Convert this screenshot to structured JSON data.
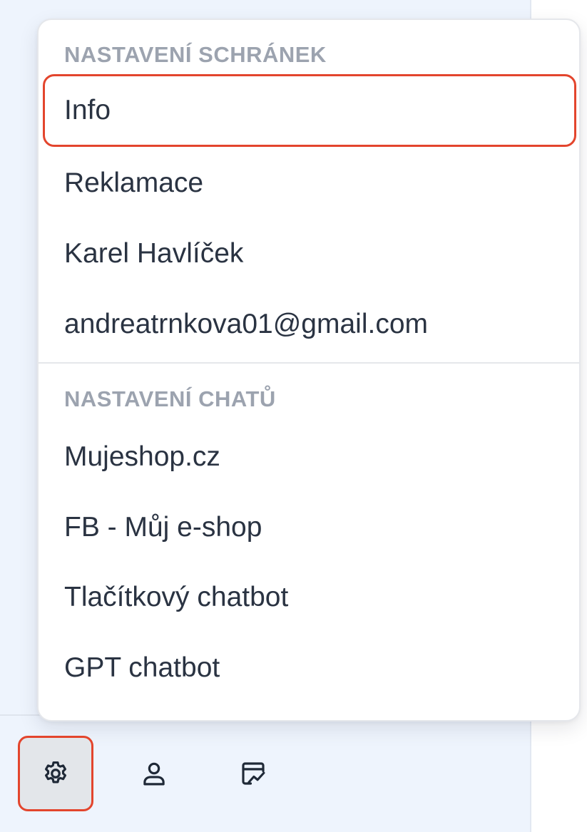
{
  "menu": {
    "sections": [
      {
        "header": "NASTAVENÍ SCHRÁNEK",
        "items": [
          "Info",
          "Reklamace",
          "Karel Havlíček",
          "andreatrnkova01@gmail.com"
        ]
      },
      {
        "header": "NASTAVENÍ CHATŮ",
        "items": [
          "Mujeshop.cz",
          "FB - Můj e-shop",
          "Tlačítkový chatbot",
          "GPT chatbot"
        ]
      }
    ],
    "highlighted_item": "Info"
  },
  "toolbar": {
    "buttons": [
      {
        "icon": "gear-icon",
        "active": true
      },
      {
        "icon": "user-icon",
        "active": false
      },
      {
        "icon": "analytics-icon",
        "active": false
      }
    ]
  },
  "colors": {
    "accent_outline": "#e3452d",
    "sidebar_background": "#eef4fd",
    "section_header": "#9ca3af",
    "item_text": "#2a3342"
  }
}
